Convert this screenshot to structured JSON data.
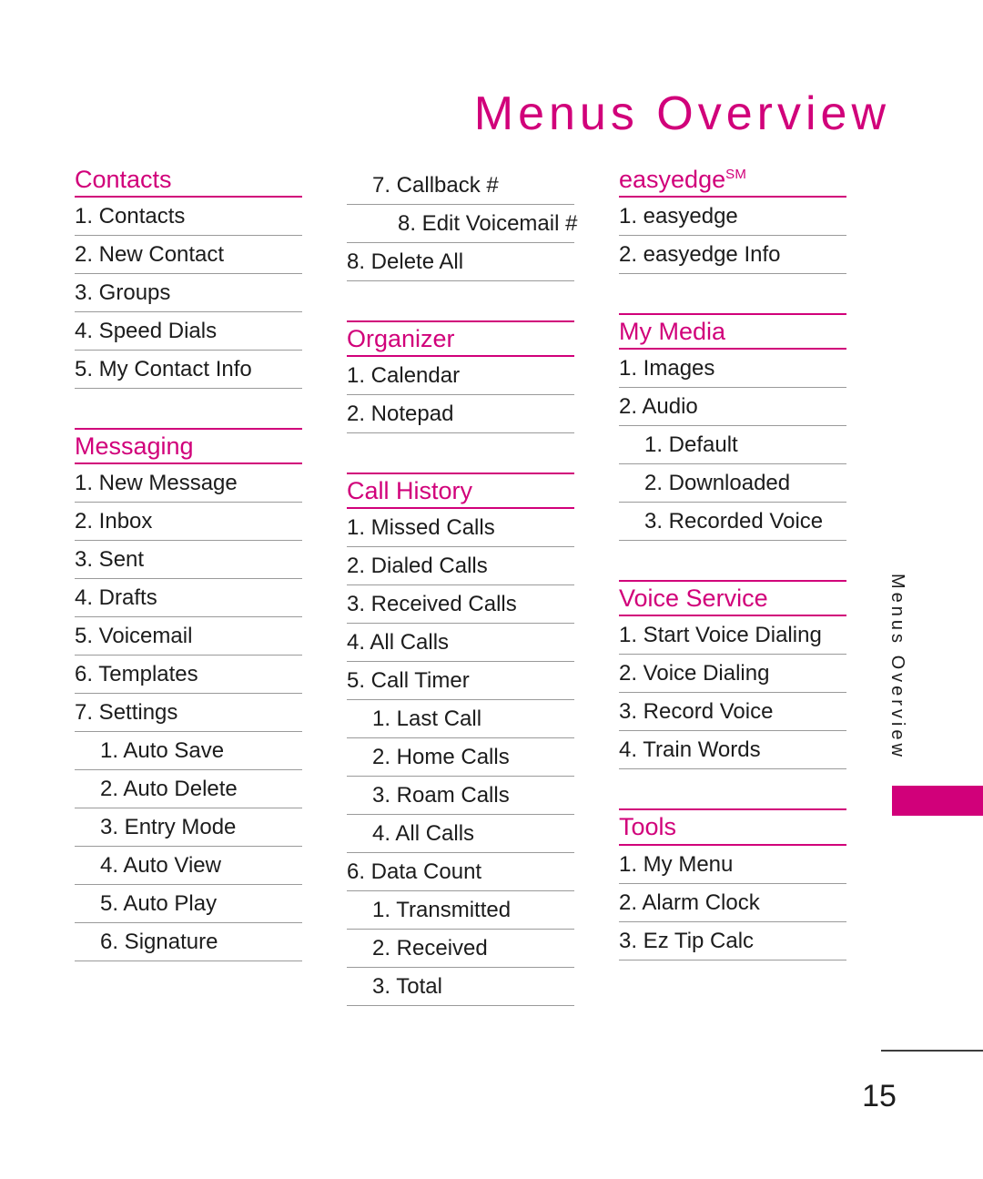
{
  "page": {
    "title": "Menus Overview",
    "side_tab_label": "Menus Overview",
    "page_number": "15",
    "accent_color": "#D1007A",
    "rule_color": "#9a9a9a",
    "text_color": "#1c1c1c"
  },
  "columns": [
    {
      "sections": [
        {
          "heading": "Contacts",
          "heading_sup": "",
          "rule_above": false,
          "items": [
            {
              "label": "1. Contacts",
              "level": 1
            },
            {
              "label": "2. New Contact",
              "level": 1
            },
            {
              "label": "3. Groups",
              "level": 1
            },
            {
              "label": "4. Speed Dials",
              "level": 1
            },
            {
              "label": "5. My Contact Info",
              "level": 1
            }
          ]
        },
        {
          "heading": "Messaging",
          "heading_sup": "",
          "rule_above": true,
          "items": [
            {
              "label": "1. New Message",
              "level": 1
            },
            {
              "label": "2. Inbox",
              "level": 1
            },
            {
              "label": "3. Sent",
              "level": 1
            },
            {
              "label": "4. Drafts",
              "level": 1
            },
            {
              "label": "5. Voicemail",
              "level": 1
            },
            {
              "label": "6. Templates",
              "level": 1
            },
            {
              "label": "7. Settings",
              "level": 1
            },
            {
              "label": "1. Auto Save",
              "level": 2
            },
            {
              "label": "2. Auto Delete",
              "level": 2
            },
            {
              "label": "3. Entry Mode",
              "level": 2
            },
            {
              "label": "4. Auto View",
              "level": 2
            },
            {
              "label": "5. Auto Play",
              "level": 2
            },
            {
              "label": "6. Signature",
              "level": 2
            }
          ]
        }
      ]
    },
    {
      "sections": [
        {
          "heading": "",
          "heading_sup": "",
          "rule_above": false,
          "items": [
            {
              "label": "7. Callback #",
              "level": 2
            },
            {
              "label": "8. Edit Voicemail #",
              "level": 3
            },
            {
              "label": "8. Delete All",
              "level": 1
            }
          ]
        },
        {
          "heading": "Organizer",
          "heading_sup": "",
          "rule_above": true,
          "items": [
            {
              "label": "1. Calendar",
              "level": 1
            },
            {
              "label": "2. Notepad",
              "level": 1
            }
          ]
        },
        {
          "heading": "Call History",
          "heading_sup": "",
          "rule_above": true,
          "items": [
            {
              "label": "1. Missed Calls",
              "level": 1
            },
            {
              "label": "2. Dialed Calls",
              "level": 1
            },
            {
              "label": "3. Received Calls",
              "level": 1
            },
            {
              "label": "4. All Calls",
              "level": 1
            },
            {
              "label": "5. Call Timer",
              "level": 1
            },
            {
              "label": "1. Last Call",
              "level": 2
            },
            {
              "label": "2. Home Calls",
              "level": 2
            },
            {
              "label": "3. Roam Calls",
              "level": 2
            },
            {
              "label": "4. All Calls",
              "level": 2
            },
            {
              "label": "6. Data Count",
              "level": 1
            },
            {
              "label": "1. Transmitted",
              "level": 2
            },
            {
              "label": "2. Received",
              "level": 2
            },
            {
              "label": "3. Total",
              "level": 2
            }
          ]
        }
      ]
    },
    {
      "sections": [
        {
          "heading": "easyedge",
          "heading_sup": "SM",
          "rule_above": false,
          "items": [
            {
              "label": "1. easyedge",
              "level": 1
            },
            {
              "label": "2. easyedge Info",
              "level": 1
            }
          ]
        },
        {
          "heading": "My Media",
          "heading_sup": "",
          "rule_above": true,
          "items": [
            {
              "label": "1. Images",
              "level": 1
            },
            {
              "label": "2. Audio",
              "level": 1
            },
            {
              "label": "1. Default",
              "level": 2
            },
            {
              "label": "2. Downloaded",
              "level": 2
            },
            {
              "label": "3. Recorded Voice",
              "level": 2
            }
          ]
        },
        {
          "heading": "Voice Service",
          "heading_sup": "",
          "rule_above": true,
          "items": [
            {
              "label": "1. Start Voice Dialing",
              "level": 1
            },
            {
              "label": "2. Voice Dialing",
              "level": 1
            },
            {
              "label": "3. Record Voice",
              "level": 1
            },
            {
              "label": "4. Train Words",
              "level": 1
            }
          ]
        },
        {
          "heading": "Tools",
          "heading_sup": "",
          "rule_above": true,
          "items": [
            {
              "label": "1. My Menu",
              "level": 1
            },
            {
              "label": "2. Alarm Clock",
              "level": 1
            },
            {
              "label": "3. Ez Tip Calc",
              "level": 1
            }
          ]
        }
      ]
    }
  ]
}
